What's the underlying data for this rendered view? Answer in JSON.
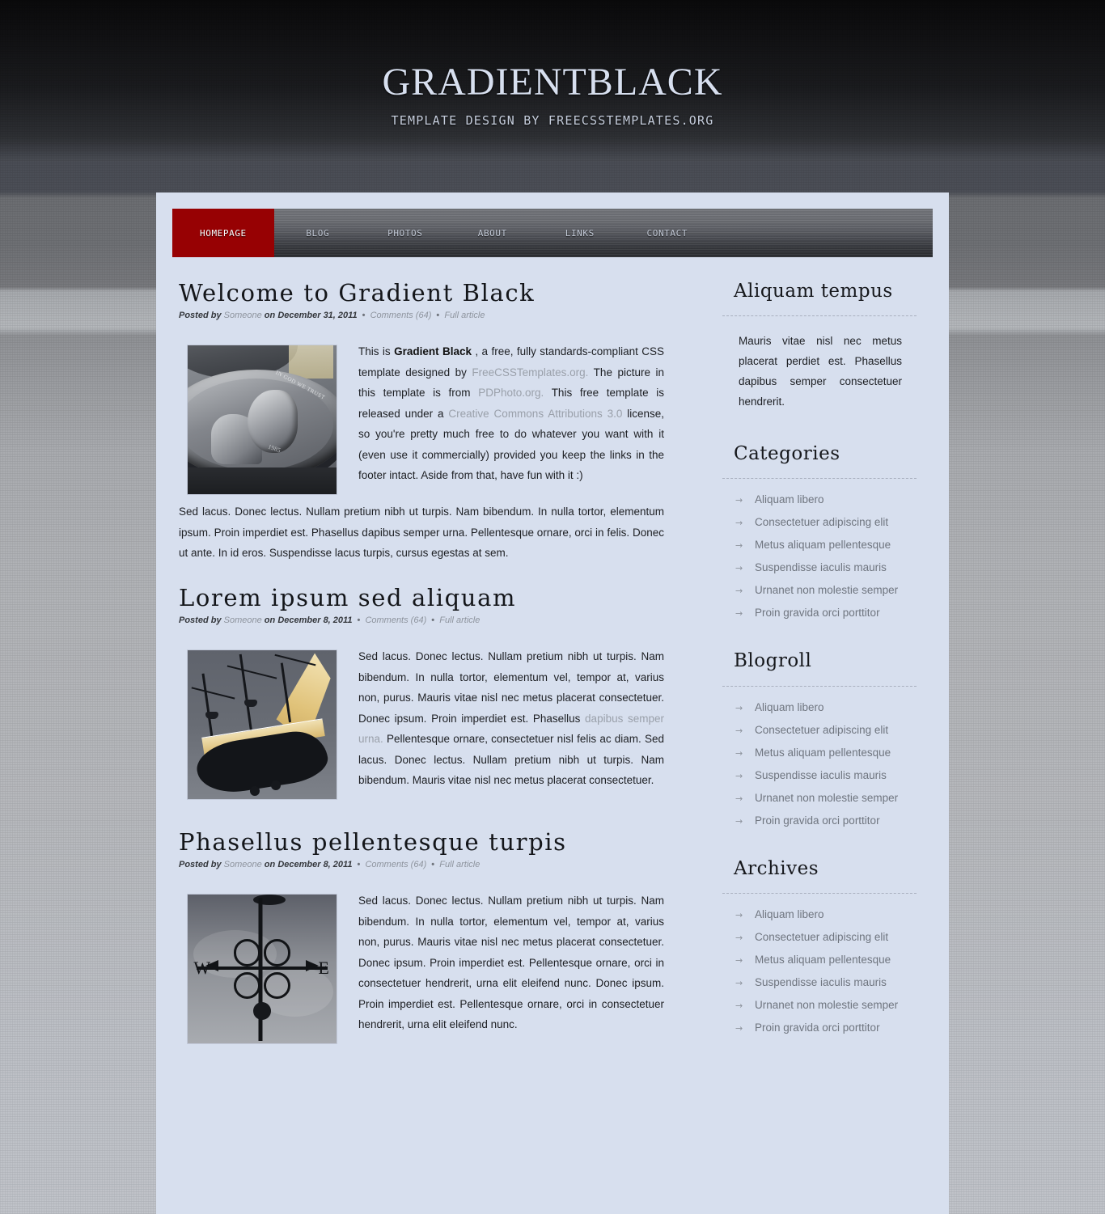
{
  "header": {
    "title": "GRADIENTBLACK",
    "tagline": "TEMPLATE DESIGN BY FREECSSTEMPLATES.ORG"
  },
  "colors": {
    "accent": "#970103",
    "content_bg": "#d7dfee",
    "link": "#9aa0aa",
    "heading": "#14161a"
  },
  "nav": {
    "items": [
      {
        "label": "HOMEPAGE",
        "active": true
      },
      {
        "label": "BLOG",
        "active": false
      },
      {
        "label": "PHOTOS",
        "active": false
      },
      {
        "label": "ABOUT",
        "active": false
      },
      {
        "label": "LINKS",
        "active": false
      },
      {
        "label": "CONTACT",
        "active": false
      }
    ]
  },
  "posts": [
    {
      "title": "Welcome to Gradient Black",
      "meta": {
        "posted_by_label": "Posted by",
        "author": "Someone",
        "on_label": "on",
        "date": "December 31, 2011",
        "comments": "Comments (64)",
        "full_article": "Full article",
        "separator": "•"
      },
      "image_name": "coin-photo",
      "body_lead_1": "This is ",
      "body_strong": "Gradient Black",
      "body_lead_2": " , a free, fully standards-compliant CSS template designed by ",
      "link_1": "FreeCSSTemplates.org.",
      "body_3": " The picture in this template is from ",
      "link_2": "PDPhoto.org.",
      "body_4": " This free template is released under a ",
      "link_3": "Creative Commons Attributions 3.0",
      "body_5": " license, so you're pretty much free to do whatever you want with it (even use it commercially) provided you keep the links in the footer intact. Aside from that, have fun with it :)",
      "paragraph_2": "Sed lacus. Donec lectus. Nullam pretium nibh ut turpis. Nam bibendum. In nulla tortor, elementum ipsum. Proin imperdiet est. Phasellus dapibus semper urna. Pellentesque ornare, orci in felis. Donec ut ante. In id eros. Suspendisse lacus turpis, cursus egestas at sem."
    },
    {
      "title": "Lorem ipsum sed aliquam",
      "meta": {
        "posted_by_label": "Posted by",
        "author": "Someone",
        "on_label": "on",
        "date": "December 8, 2011",
        "comments": "Comments (64)",
        "full_article": "Full article",
        "separator": "•"
      },
      "image_name": "ship-photo",
      "body_1": "Sed lacus. Donec lectus. Nullam pretium nibh ut turpis. Nam bibendum. In nulla tortor, elementum vel, tempor at, varius non, purus. Mauris vitae nisl nec metus placerat consectetuer. Donec ipsum. Proin imperdiet est. Phasellus ",
      "link_1": "dapibus semper urna.",
      "body_2": " Pellentesque ornare, consectetuer nisl felis ac diam. Sed lacus. Donec lectus. Nullam pretium nibh ut turpis. Nam bibendum. Mauris vitae nisl nec metus placerat consectetuer."
    },
    {
      "title": "Phasellus pellentesque turpis",
      "meta": {
        "posted_by_label": "Posted by",
        "author": "Someone",
        "on_label": "on",
        "date": "December 8, 2011",
        "comments": "Comments (64)",
        "full_article": "Full article",
        "separator": "•"
      },
      "image_name": "weathervane-photo",
      "body_1": "Sed lacus. Donec lectus. Nullam pretium nibh ut turpis. Nam bibendum. In nulla tortor, elementum vel, tempor at, varius non, purus. Mauris vitae nisl nec metus placerat consectetuer. Donec ipsum. Proin imperdiet est. Pellentesque ornare, orci in consectetuer hendrerit, urna elit eleifend nunc. Donec ipsum. Proin imperdiet est. Pellentesque ornare, orci in consectetuer hendrerit, urna elit eleifend nunc."
    }
  ],
  "sidebar": {
    "blocks": [
      {
        "title": "Aliquam tempus",
        "type": "text",
        "text": "Mauris vitae nisl nec metus placerat perdiet est. Phasellus dapibus semper consectetuer hendrerit."
      },
      {
        "title": "Categories",
        "type": "list",
        "bullet": "→",
        "items": [
          "Aliquam libero",
          "Consectetuer adipiscing elit",
          "Metus aliquam pellentesque",
          "Suspendisse iaculis mauris",
          "Urnanet non molestie semper",
          "Proin gravida orci porttitor"
        ]
      },
      {
        "title": "Blogroll",
        "type": "list",
        "bullet": "→",
        "items": [
          "Aliquam libero",
          "Consectetuer adipiscing elit",
          "Metus aliquam pellentesque",
          "Suspendisse iaculis mauris",
          "Urnanet non molestie semper",
          "Proin gravida orci porttitor"
        ]
      },
      {
        "title": "Archives",
        "type": "list",
        "bullet": "→",
        "items": [
          "Aliquam libero",
          "Consectetuer adipiscing elit",
          "Metus aliquam pellentesque",
          "Suspendisse iaculis mauris",
          "Urnanet non molestie semper",
          "Proin gravida orci porttitor"
        ]
      }
    ]
  },
  "artwork": {
    "coin_legend": "IN GOD WE TRUST",
    "coin_date": "1985",
    "vane_west": "W",
    "vane_east": "E"
  }
}
